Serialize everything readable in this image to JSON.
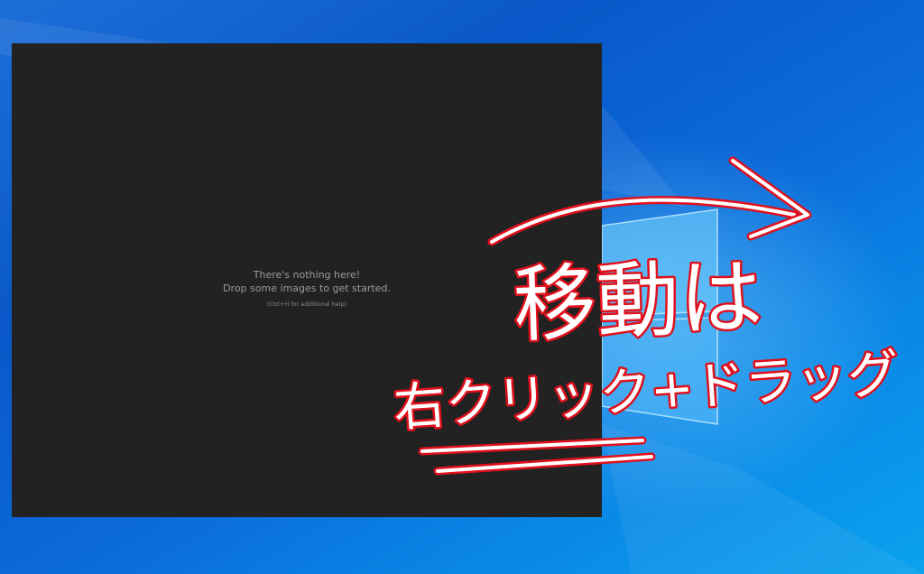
{
  "desktop": {
    "wallpaper": "windows-10-hero",
    "colors": {
      "deep_blue": "#0a58c9",
      "light_blue": "#0aa2ee"
    }
  },
  "viewer": {
    "background_color": "#222222",
    "empty_line_1": "There's nothing here!",
    "empty_line_2": "Drop some images to get started.",
    "help_hint": "(Ctrl+H for additional help)"
  },
  "annotation": {
    "line_1": "移動は",
    "line_2": "右クリック+ドラッグ",
    "stroke_color": "#e0101c",
    "fill_color": "#ffffff",
    "arrow_direction": "right"
  }
}
